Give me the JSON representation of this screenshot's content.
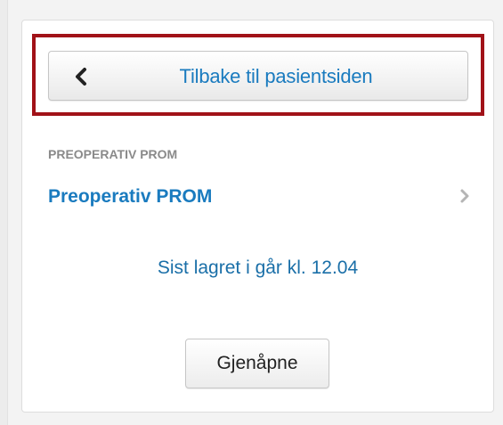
{
  "back_button": {
    "label": "Tilbake til pasientsiden",
    "icon": "chevron-left-icon"
  },
  "section": {
    "header": "PREOPERATIV PROM",
    "item_label": "Preoperativ PROM",
    "item_icon": "chevron-right-icon"
  },
  "status": {
    "text": "Sist lagret i går kl. 12.04"
  },
  "reopen_button": {
    "label": "Gjenåpne"
  },
  "colors": {
    "accent": "#1a7bbf",
    "highlight": "#a11218",
    "muted": "#8a8a8a"
  }
}
